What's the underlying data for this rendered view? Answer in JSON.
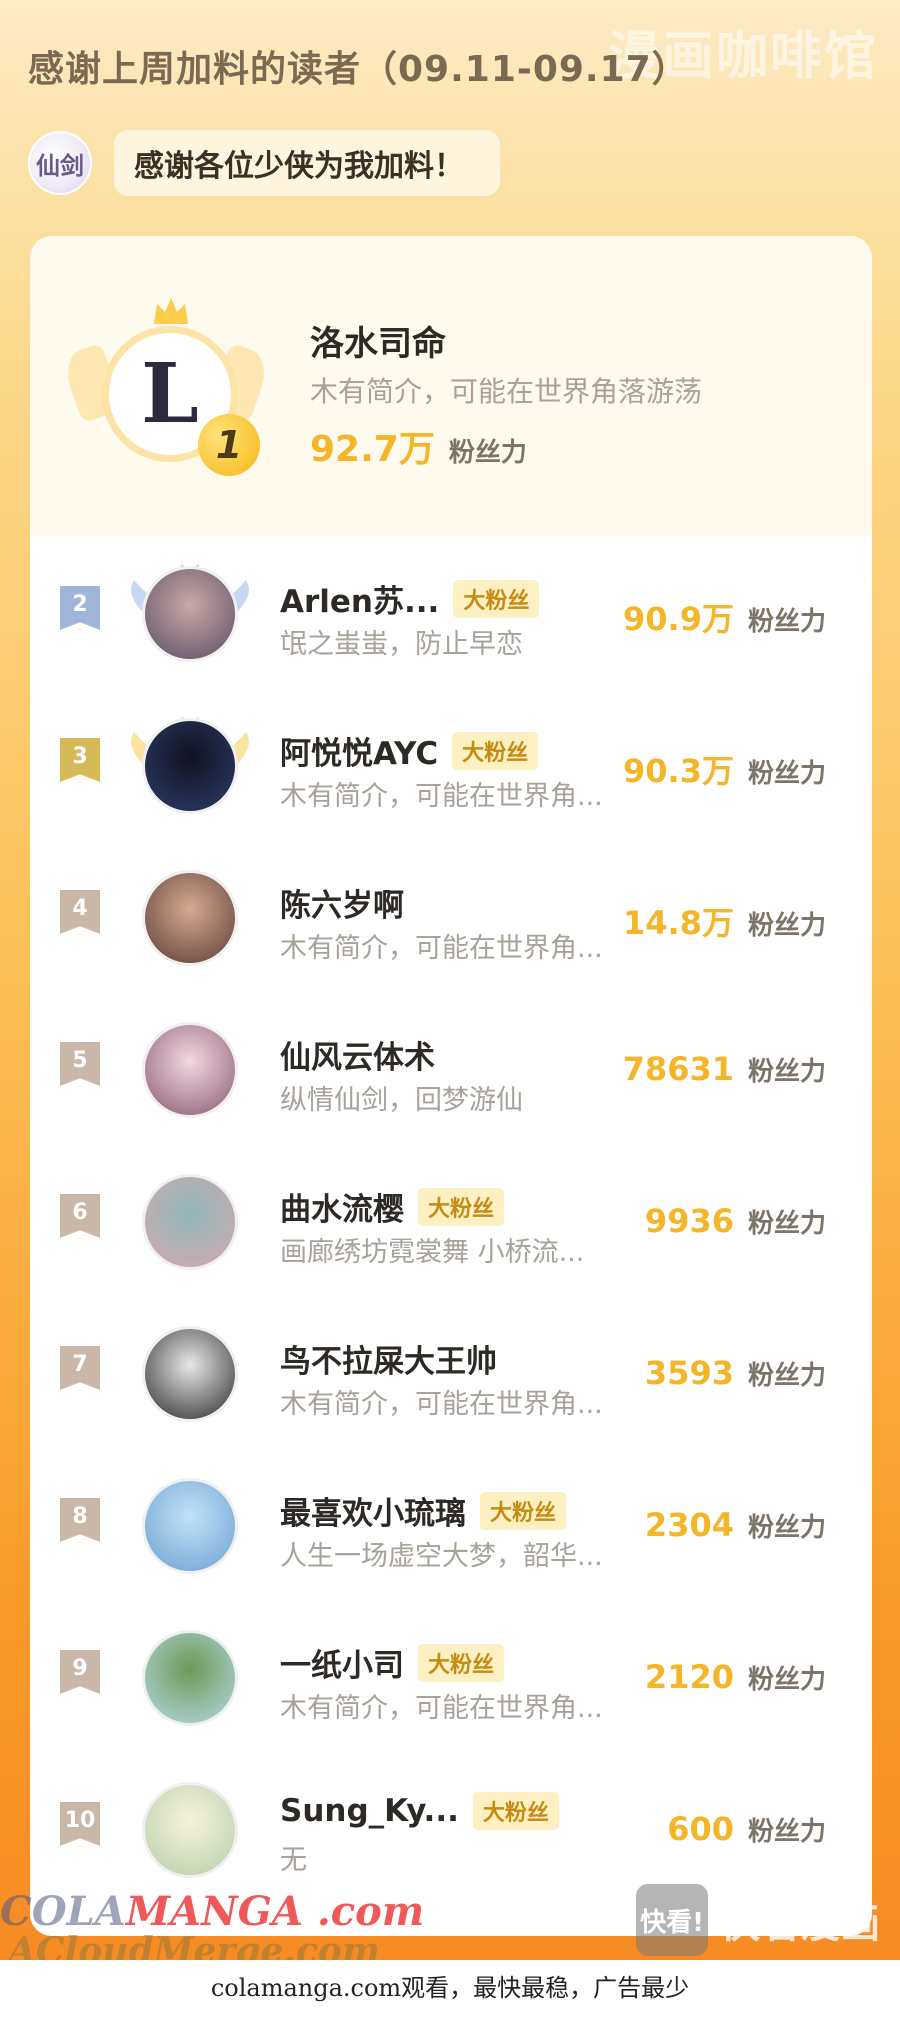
{
  "watermark_top": "漫画咖啡馆",
  "header": {
    "title": "感谢上周加料的读者（09.11-09.17）"
  },
  "banner": {
    "logo_text": "仙剑",
    "message": "感谢各位少侠为我加料！"
  },
  "rank1": {
    "rank": "1",
    "name": "洛水司命",
    "bio": "木有简介，可能在世界角落游荡",
    "score": "92.7万",
    "unit": "粉丝力",
    "avatar_glyph": "L"
  },
  "colors": {
    "accent": "#f5b528",
    "silver": "#9fb5d9",
    "gold": "#d8b957",
    "bronze": "#c9b7a7"
  },
  "readers": [
    {
      "rank": "2",
      "name": "Arlen苏...",
      "badge": "大粉丝",
      "bio": "氓之蚩蚩，防止早恋",
      "score": "90.9万",
      "unit": "粉丝力",
      "flag": "silver"
    },
    {
      "rank": "3",
      "name": "阿悦悦AYC",
      "badge": "大粉丝",
      "bio": "木有简介，可能在世界角...",
      "score": "90.3万",
      "unit": "粉丝力",
      "flag": "gold"
    },
    {
      "rank": "4",
      "name": "陈六岁啊",
      "badge": "",
      "bio": "木有简介，可能在世界角...",
      "score": "14.8万",
      "unit": "粉丝力",
      "flag": "bronze"
    },
    {
      "rank": "5",
      "name": "仙风云体术",
      "badge": "",
      "bio": "纵情仙剑，回梦游仙",
      "score": "78631",
      "unit": "粉丝力",
      "flag": "bronze"
    },
    {
      "rank": "6",
      "name": "曲水流樱",
      "badge": "大粉丝",
      "bio": "画廊绣坊霓裳舞 小桥流...",
      "score": "9936",
      "unit": "粉丝力",
      "flag": "bronze"
    },
    {
      "rank": "7",
      "name": "鸟不拉屎大王帅",
      "badge": "",
      "bio": "木有简介，可能在世界角...",
      "score": "3593",
      "unit": "粉丝力",
      "flag": "bronze"
    },
    {
      "rank": "8",
      "name": "最喜欢小琉璃",
      "badge": "大粉丝",
      "bio": "人生一场虚空大梦，韶华...",
      "score": "2304",
      "unit": "粉丝力",
      "flag": "bronze"
    },
    {
      "rank": "9",
      "name": "一纸小司",
      "badge": "大粉丝",
      "bio": "木有简介，可能在世界角...",
      "score": "2120",
      "unit": "粉丝力",
      "flag": "bronze"
    },
    {
      "rank": "10",
      "name": "Sung_Ky...",
      "badge": "大粉丝",
      "bio": "无",
      "score": "600",
      "unit": "粉丝力",
      "flag": "bronze"
    }
  ],
  "watermarks": {
    "colamanga_1": "COLA",
    "colamanga_2": "MANGA",
    "colamanga_3": ".com",
    "acloud": "ACloudMerge.com",
    "kuaikan_box": "快看!",
    "kuaikan_text": "快看漫画"
  },
  "footer": {
    "text": "colamanga.com观看，最快最稳，广告最少"
  }
}
